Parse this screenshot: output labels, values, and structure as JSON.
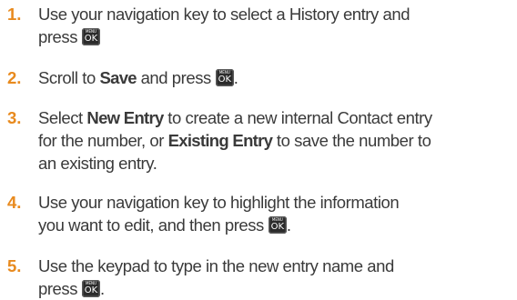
{
  "key": {
    "menu": "MENU",
    "ok": "OK"
  },
  "steps": [
    {
      "number": "1.",
      "line1": "Use your navigation key to select a History entry and",
      "line2": "press"
    },
    {
      "number": "2.",
      "pre": "Scroll to",
      "bold": "Save",
      "post": "and press",
      "end": "."
    },
    {
      "number": "3.",
      "pre": "Select",
      "bold1": "New Entry",
      "mid1": "to create a new internal Contact entry",
      "line2_pre": "for the number, or",
      "bold2": "Existing Entry",
      "line2_post": "to save the number to",
      "line3": "an existing entry."
    },
    {
      "number": "4.",
      "line1": "Use your navigation key to highlight the information",
      "line2": "you want to edit, and then press",
      "end": "."
    },
    {
      "number": "5.",
      "line1": "Use the keypad to type in the new entry name and",
      "line2": "press",
      "end": "."
    }
  ]
}
